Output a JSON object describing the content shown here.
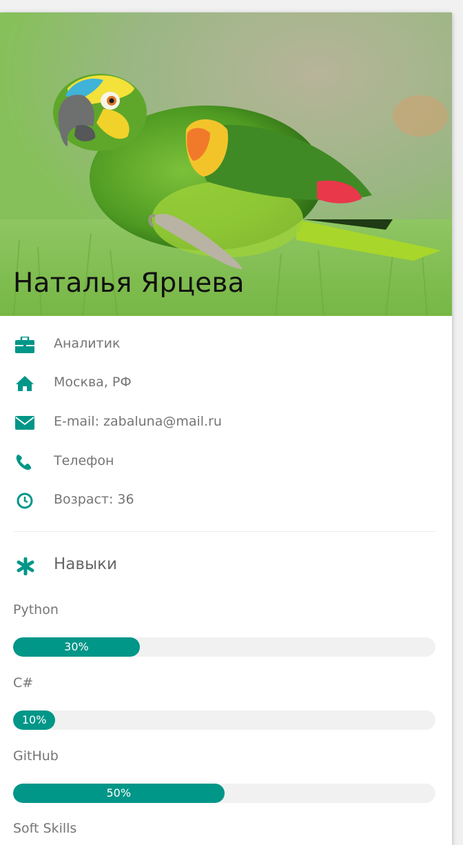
{
  "profile": {
    "name": "Наталья Ярцева",
    "photo": "parrot-photo"
  },
  "details": [
    {
      "icon": "briefcase-icon",
      "text": "Аналитик"
    },
    {
      "icon": "home-icon",
      "text": "Москва, РФ"
    },
    {
      "icon": "envelope-icon",
      "text": "E-mail: zabaluna@mail.ru"
    },
    {
      "icon": "phone-icon",
      "text": "Телефон"
    },
    {
      "icon": "clock-icon",
      "text": "Возраст: 36"
    }
  ],
  "skills": {
    "title": "Навыки",
    "icon": "asterisk-icon",
    "items": [
      {
        "name": "Python",
        "percent": 30,
        "label": "30%"
      },
      {
        "name": "C#",
        "percent": 10,
        "label": "10%"
      },
      {
        "name": "GitHub",
        "percent": 50,
        "label": "50%"
      },
      {
        "name": "Soft Skills"
      }
    ]
  },
  "colors": {
    "accent": "#009688",
    "bar_track": "#f1f1f1",
    "text": "#757575"
  }
}
